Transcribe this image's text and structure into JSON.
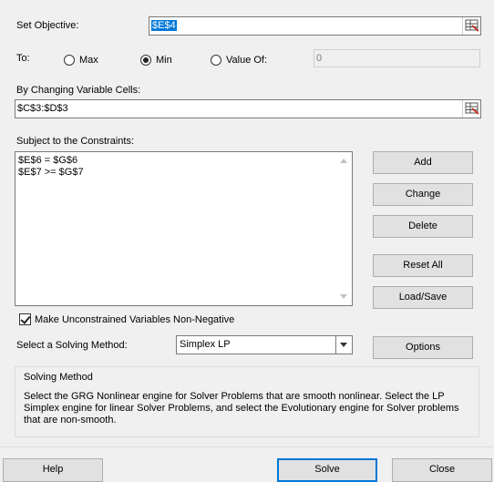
{
  "objective": {
    "label": "Set Objective:",
    "value": "$E$4"
  },
  "to": {
    "label": "To:",
    "options": [
      "Max",
      "Min",
      "Value Of:"
    ],
    "selected": "Min",
    "value_of": "0"
  },
  "changing_cells": {
    "label": "By Changing Variable Cells:",
    "value": "$C$3:$D$3"
  },
  "constraints": {
    "label": "Subject to the Constraints:",
    "items": [
      "$E$6 = $G$6",
      "$E$7 >= $G$7"
    ]
  },
  "side_buttons": {
    "add": "Add",
    "change": "Change",
    "delete": "Delete",
    "reset_all": "Reset All",
    "load_save": "Load/Save",
    "options": "Options"
  },
  "nonnegative": {
    "label": "Make Unconstrained Variables Non-Negative",
    "checked": true
  },
  "method": {
    "label": "Select a Solving Method:",
    "value": "Simplex LP"
  },
  "solving_method_group": {
    "title": "Solving Method",
    "description": "Select the GRG Nonlinear engine for Solver Problems that are smooth nonlinear. Select the LP Simplex engine for linear Solver Problems, and select the Evolutionary engine for Solver problems that are non-smooth."
  },
  "footer": {
    "help": "Help",
    "solve": "Solve",
    "close": "Close"
  }
}
